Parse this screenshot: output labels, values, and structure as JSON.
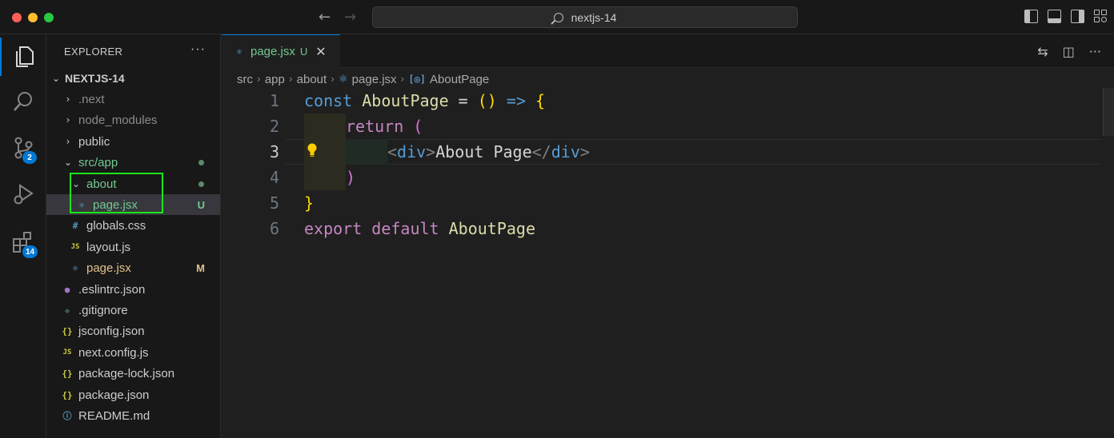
{
  "window": {
    "search_text": "nextjs-14"
  },
  "activity_bar": {
    "items": [
      {
        "name": "explorer-icon",
        "badge": ""
      },
      {
        "name": "search-icon",
        "badge": ""
      },
      {
        "name": "source-control-icon",
        "badge": "2"
      },
      {
        "name": "run-debug-icon",
        "badge": ""
      },
      {
        "name": "extensions-icon",
        "badge": "14"
      }
    ]
  },
  "sidebar": {
    "title": "EXPLORER",
    "more": "···",
    "root": "NEXTJS-14",
    "rows": [
      {
        "label": ".next",
        "type": "folder",
        "status": ""
      },
      {
        "label": "node_modules",
        "type": "folder",
        "status": ""
      },
      {
        "label": "public",
        "type": "folder",
        "status": ""
      },
      {
        "label": "src/app",
        "type": "folder-open",
        "status": "dot"
      },
      {
        "label": "about",
        "type": "folder-open",
        "status": "dot"
      },
      {
        "label": "page.jsx",
        "type": "react",
        "status": "U"
      },
      {
        "label": "globals.css",
        "type": "css",
        "status": ""
      },
      {
        "label": "layout.js",
        "type": "js",
        "status": ""
      },
      {
        "label": "page.jsx",
        "type": "react",
        "status": "M"
      },
      {
        "label": ".eslintrc.json",
        "type": "eslint",
        "status": ""
      },
      {
        "label": ".gitignore",
        "type": "git",
        "status": ""
      },
      {
        "label": "jsconfig.json",
        "type": "json",
        "status": ""
      },
      {
        "label": "next.config.js",
        "type": "js",
        "status": ""
      },
      {
        "label": "package-lock.json",
        "type": "json",
        "status": ""
      },
      {
        "label": "package.json",
        "type": "json",
        "status": ""
      },
      {
        "label": "README.md",
        "type": "info",
        "status": ""
      }
    ]
  },
  "editor": {
    "tab": {
      "name": "page.jsx",
      "status": "U",
      "close": "✕"
    },
    "breadcrumb": [
      "src",
      "app",
      "about",
      "page.jsx",
      "AboutPage"
    ],
    "lines": [
      {
        "n": "1"
      },
      {
        "n": "2"
      },
      {
        "n": "3"
      },
      {
        "n": "4"
      },
      {
        "n": "5"
      },
      {
        "n": "6"
      }
    ],
    "code": {
      "const": "const",
      "component": "AboutPage",
      "eq": " = ",
      "parens": "()",
      "arrow": " => ",
      "open_brace": "{",
      "return": "return",
      "open_paren": "(",
      "lt": "<",
      "div": "div",
      "gt": ">",
      "inner_text": "About Page",
      "close_lt": "</",
      "close_paren": ")",
      "close_brace": "}",
      "export": "export",
      "default": "default"
    }
  },
  "colors": {
    "accent": "#0078d4",
    "added": "#73c991",
    "modified": "#e2c08d",
    "highlight_box": "#19e619"
  }
}
